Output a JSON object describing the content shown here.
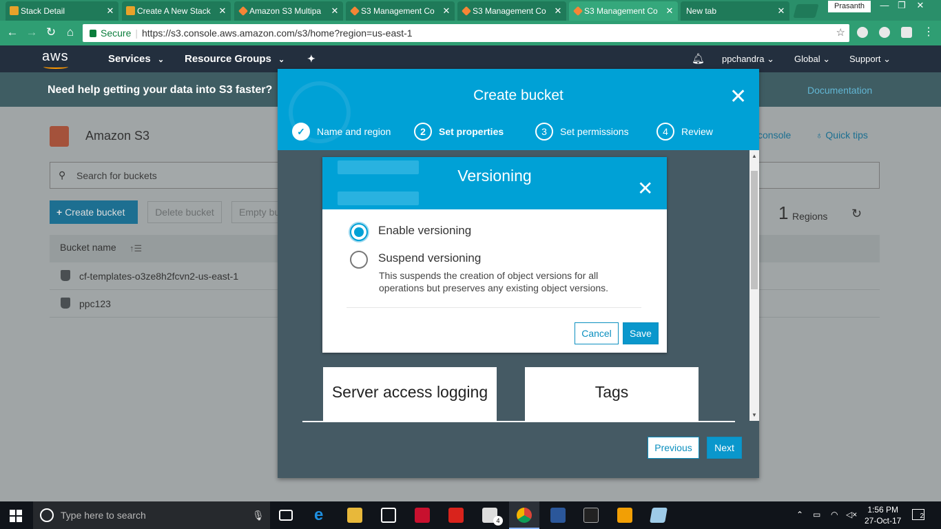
{
  "browser": {
    "tabs": [
      {
        "title": "Stack Detail",
        "icon": "aws-cube-icon",
        "color": "#e8a22a",
        "active": false
      },
      {
        "title": "Create A New Stack",
        "icon": "aws-cube-icon",
        "color": "#e8a22a",
        "active": false
      },
      {
        "title": "Amazon S3 Multipa",
        "icon": "aws-s3-icon",
        "color": "#f58536",
        "active": false
      },
      {
        "title": "S3 Management Co",
        "icon": "aws-s3-icon",
        "color": "#f58536",
        "active": false
      },
      {
        "title": "S3 Management Co",
        "icon": "aws-s3-icon",
        "color": "#f58536",
        "active": false
      },
      {
        "title": "S3 Management Co",
        "icon": "aws-s3-icon",
        "color": "#f58536",
        "active": true
      },
      {
        "title": "New tab",
        "icon": "",
        "color": "",
        "active": false
      }
    ],
    "profile": "Prasanth",
    "secure_label": "Secure",
    "url": "https://s3.console.aws.amazon.com/s3/home?region=us-east-1"
  },
  "aws_nav": {
    "logo": "aws",
    "services": "Services",
    "resource_groups": "Resource Groups",
    "user": "ppchandra",
    "region": "Global",
    "support": "Support"
  },
  "banner": {
    "question": "Need help getting your data into S3 faster?",
    "documentation": "Documentation"
  },
  "s3_page": {
    "title": "Amazon S3",
    "search_placeholder": "Search for buckets",
    "create_bucket": "Create bucket",
    "delete_bucket": "Delete bucket",
    "empty_bucket": "Empty bu",
    "regions_count": "1",
    "regions_label": "Regions",
    "column_bucket_name": "Bucket name",
    "buckets": [
      "cf-templates-o3ze8h2fcvn2-us-east-1",
      "ppc123"
    ],
    "console_link": "console",
    "quick_tips": "Quick tips"
  },
  "modal": {
    "title": "Create bucket",
    "steps": [
      {
        "number": "1",
        "label": "Name and region",
        "state": "done"
      },
      {
        "number": "2",
        "label": "Set properties",
        "state": "current"
      },
      {
        "number": "3",
        "label": "Set permissions",
        "state": "todo"
      },
      {
        "number": "4",
        "label": "Review",
        "state": "todo"
      }
    ],
    "cards": [
      "Server access logging",
      "Tags"
    ],
    "previous": "Previous",
    "next": "Next"
  },
  "versioning": {
    "title": "Versioning",
    "enable_label": "Enable versioning",
    "suspend_label": "Suspend versioning",
    "suspend_desc": "This suspends the creation of object versions for all operations but preserves any existing object versions.",
    "selected": "enable",
    "cancel": "Cancel",
    "save": "Save"
  },
  "taskbar": {
    "search_placeholder": "Type here to search",
    "time": "1:56 PM",
    "date": "27-Oct-17",
    "notification_count": "2",
    "mail_badge": "4"
  },
  "colors": {
    "chrome_green": "#2f9e73",
    "aws_nav": "#232f3e",
    "accent_blue": "#00a1d6",
    "modal_body": "#455a64"
  }
}
